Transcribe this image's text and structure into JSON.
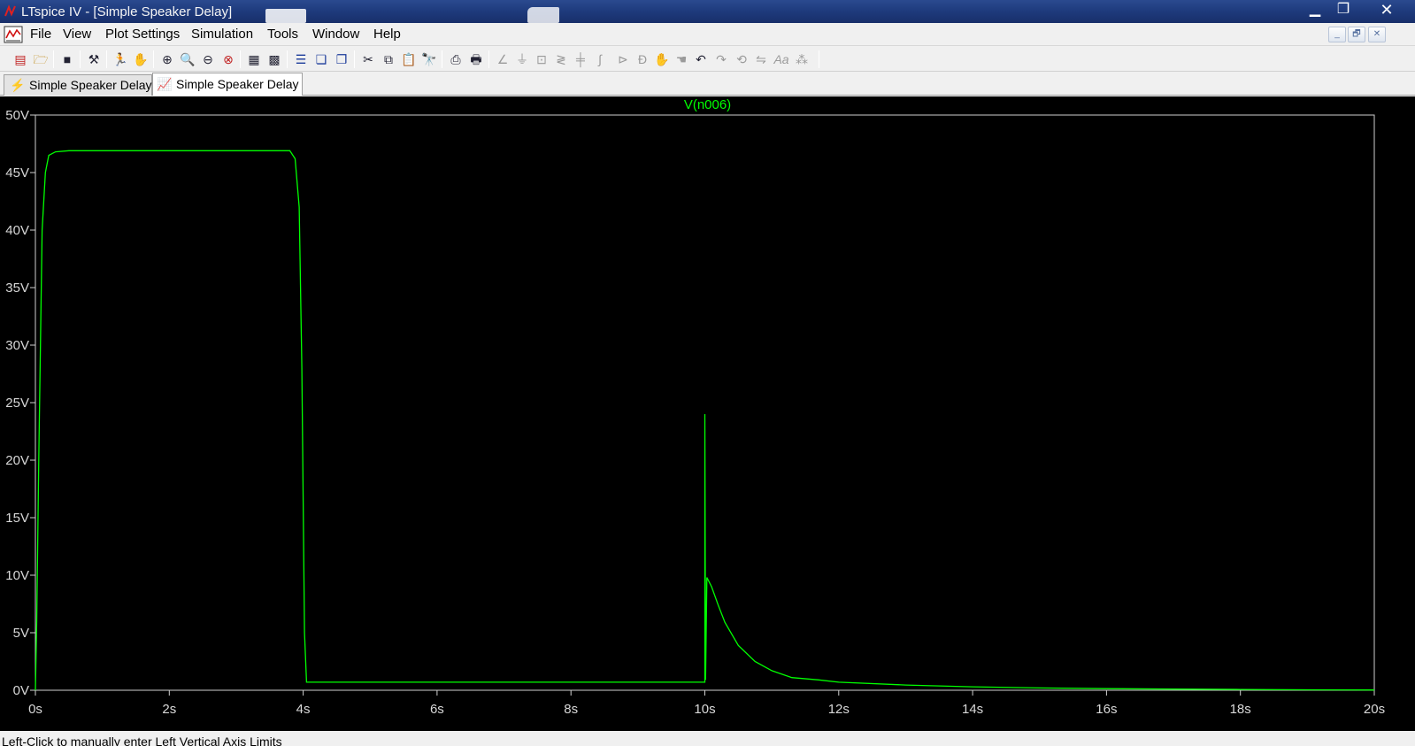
{
  "window": {
    "title": "LTspice IV - [Simple Speaker Delay]"
  },
  "menu": {
    "items": [
      "File",
      "View",
      "Plot Settings",
      "Simulation",
      "Tools",
      "Window",
      "Help"
    ]
  },
  "mdi_controls": [
    "_",
    "🗗",
    "✕"
  ],
  "toolbar": {
    "icons": [
      "new-schematic-icon",
      "open-icon",
      "save-icon",
      "control-panel-icon",
      "run-icon",
      "pan-icon",
      "zoom-in-icon",
      "zoom-area-icon",
      "zoom-out-icon",
      "zoom-fit-icon",
      "autorange-icon",
      "plot-settings-icon",
      "tile-horizontal-icon",
      "cascade-icon",
      "tile-vertical-icon",
      "cut-icon",
      "copy-icon",
      "paste-icon",
      "find-icon",
      "print-preview-icon",
      "print-icon",
      "wire-icon",
      "ground-icon",
      "label-net-icon",
      "resistor-icon",
      "capacitor-icon",
      "inductor-icon",
      "diode-icon",
      "component-icon",
      "move-icon",
      "drag-icon",
      "undo-icon",
      "redo-icon",
      "rotate-icon",
      "mirror-icon",
      "text-icon",
      "spice-directive-icon"
    ]
  },
  "tabs": [
    {
      "label": "Simple Speaker Delay",
      "kind": "schematic"
    },
    {
      "label": "Simple Speaker Delay",
      "kind": "waveform"
    }
  ],
  "plot": {
    "trace_name": "V(n006)",
    "trace_color": "#00ff00",
    "background": "#000000"
  },
  "chart_data": {
    "type": "line",
    "title": "V(n006)",
    "xlabel": "",
    "ylabel": "",
    "xlim": [
      0,
      20
    ],
    "ylim": [
      0,
      50
    ],
    "x_ticks": [
      "0s",
      "2s",
      "4s",
      "6s",
      "8s",
      "10s",
      "12s",
      "14s",
      "16s",
      "18s",
      "20s"
    ],
    "y_ticks": [
      "0V",
      "5V",
      "10V",
      "15V",
      "20V",
      "25V",
      "30V",
      "35V",
      "40V",
      "45V",
      "50V"
    ],
    "grid": false,
    "series": [
      {
        "name": "V(n006)",
        "x": [
          0,
          0.02,
          0.05,
          0.1,
          0.15,
          0.2,
          0.3,
          0.5,
          1.0,
          2.0,
          3.0,
          3.8,
          3.88,
          3.94,
          3.98,
          4.02,
          4.05,
          5.0,
          7.0,
          9.0,
          10.0,
          10.0,
          10.01,
          10.03,
          10.1,
          10.2,
          10.3,
          10.5,
          10.75,
          11.0,
          11.3,
          11.7,
          12.0,
          13.0,
          14.0,
          15.0,
          16.0,
          17.0,
          18.0,
          19.0,
          20.0
        ],
        "y": [
          0,
          6,
          20,
          40,
          45,
          46.5,
          46.8,
          46.9,
          46.9,
          46.9,
          46.9,
          46.9,
          46.2,
          42,
          28,
          5,
          0.7,
          0.7,
          0.7,
          0.7,
          0.7,
          24,
          0.9,
          9.8,
          9.0,
          7.4,
          5.9,
          3.9,
          2.5,
          1.7,
          1.1,
          0.9,
          0.7,
          0.45,
          0.3,
          0.2,
          0.14,
          0.1,
          0.07,
          0.04,
          0.02
        ]
      }
    ]
  },
  "status": {
    "message": "Left-Click to manually enter Left Vertical Axis Limits"
  }
}
